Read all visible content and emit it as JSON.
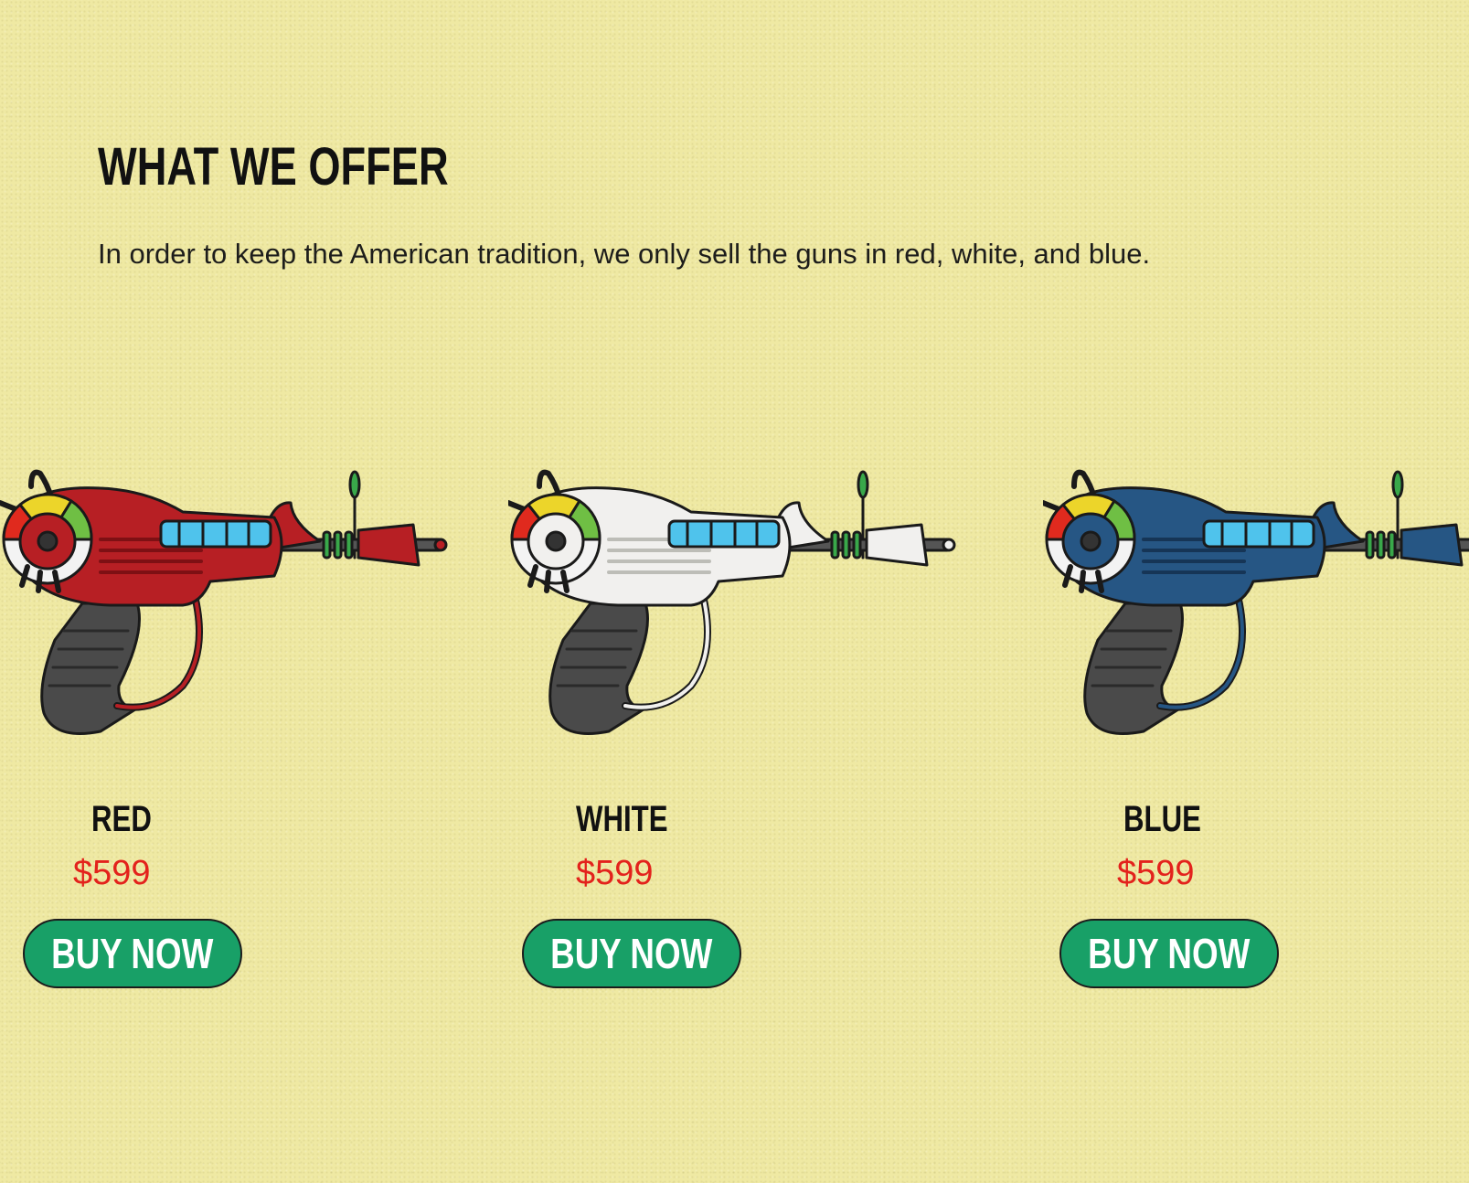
{
  "section": {
    "title": "WHAT WE OFFER",
    "subtitle": "In order to keep the American tradition, we only sell the guns in red, white, and blue."
  },
  "products": [
    {
      "name": "RED",
      "price": "$599",
      "button_label": "BUY NOW",
      "color": "#b71f24",
      "shade": "#7e1014"
    },
    {
      "name": "WHITE",
      "price": "$599",
      "button_label": "BUY NOW",
      "color": "#f1f0ee",
      "shade": "#bdbdb7"
    },
    {
      "name": "BLUE",
      "price": "$599",
      "button_label": "BUY NOW",
      "color": "#265684",
      "shade": "#163556"
    }
  ],
  "colors": {
    "background": "#efe9a3",
    "price": "#e3221c",
    "button": "#18a067",
    "glass": "#4fc3ec",
    "ring": "#39a84a",
    "grip": "#4a4a4a"
  }
}
